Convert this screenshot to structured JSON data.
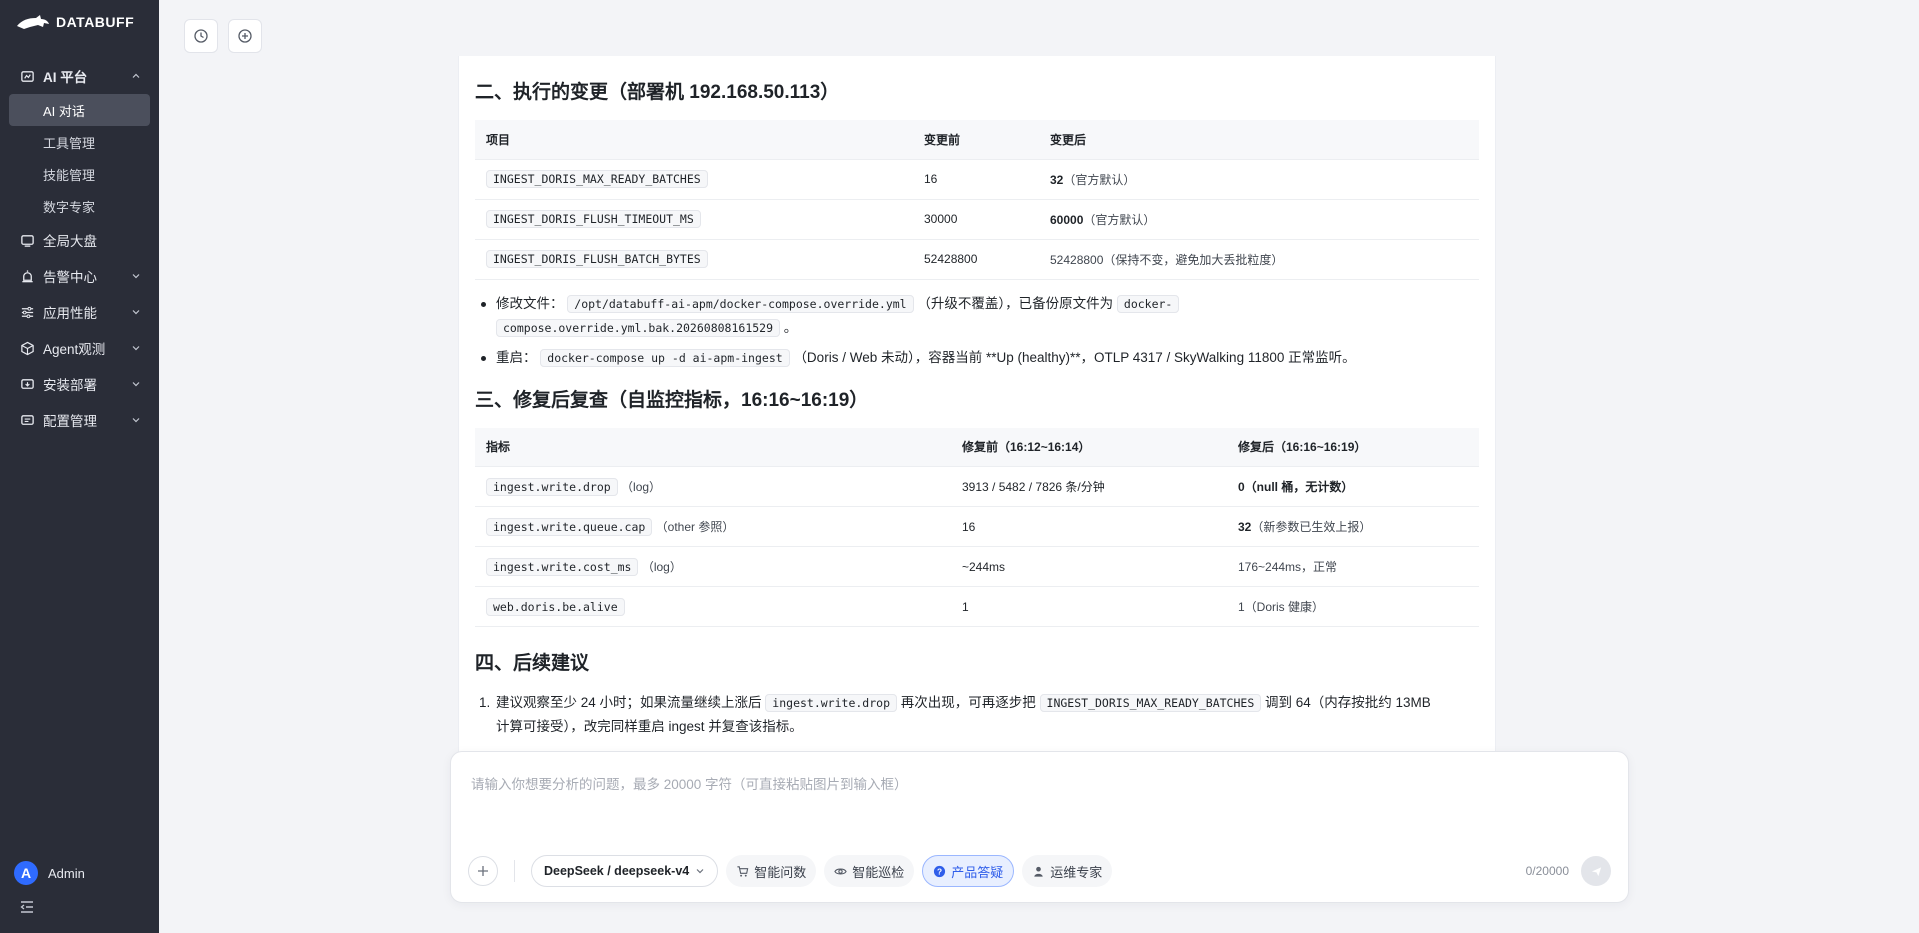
{
  "brand": {
    "name": "DATABUFF"
  },
  "sidebar": {
    "groups": [
      {
        "label": "AI 平台",
        "icon": "ai-platform-icon",
        "expanded": true,
        "items": [
          {
            "label": "AI 对话",
            "active": true
          },
          {
            "label": "工具管理"
          },
          {
            "label": "技能管理"
          },
          {
            "label": "数字专家"
          }
        ]
      },
      {
        "label": "全局大盘",
        "icon": "dashboard-icon"
      },
      {
        "label": "告警中心",
        "icon": "alarm-icon"
      },
      {
        "label": "应用性能",
        "icon": "performance-icon"
      },
      {
        "label": "Agent观测",
        "icon": "agent-icon"
      },
      {
        "label": "安装部署",
        "icon": "deploy-icon"
      },
      {
        "label": "配置管理",
        "icon": "config-icon"
      }
    ],
    "user": {
      "initial": "A",
      "name": "Admin"
    }
  },
  "sections": {
    "s2": {
      "title": "二、执行的变更（部署机 192.168.50.113）",
      "headers": [
        "项目",
        "变更前",
        "变更后"
      ],
      "rows": [
        {
          "item": "INGEST_DORIS_MAX_READY_BATCHES",
          "before": "16",
          "after_bold": "32",
          "after_note": "（官方默认）"
        },
        {
          "item": "INGEST_DORIS_FLUSH_TIMEOUT_MS",
          "before": "30000",
          "after_bold": "60000",
          "after_note": "（官方默认）"
        },
        {
          "item": "INGEST_DORIS_FLUSH_BATCH_BYTES",
          "before": "52428800",
          "after_bold": "",
          "after_note": "52428800（保持不变，避免加大丢批粒度）"
        }
      ],
      "bullets": {
        "b1_prefix": "修改文件：",
        "b1_code1": "/opt/databuff-ai-apm/docker-compose.override.yml",
        "b1_mid": "（升级不覆盖），已备份原文件为",
        "b1_code2a": "docker-",
        "b1_code2b": "compose.override.yml.bak.20260808161529",
        "b1_suffix": "。",
        "b2_prefix": "重启：",
        "b2_code": "docker-compose up -d ai-apm-ingest",
        "b2_suffix": "（Doris / Web 未动），容器当前 **Up (healthy)**，OTLP 4317 / SkyWalking 11800 正常监听。"
      }
    },
    "s3": {
      "title": "三、修复后复查（自监控指标，16:16~16:19）",
      "headers": [
        "指标",
        "修复前（16:12~16:14）",
        "修复后（16:16~16:19）"
      ],
      "rows": [
        {
          "metric": "ingest.write.drop",
          "metric_note": "（log）",
          "before": "3913 / 5482 / 7826 条/分钟",
          "after_bold": "0（null 桶，无计数）",
          "after_note": ""
        },
        {
          "metric": "ingest.write.queue.cap",
          "metric_note": "（other 参照）",
          "before": "16",
          "after_bold": "32",
          "after_note": "（新参数已生效上报）"
        },
        {
          "metric": "ingest.write.cost_ms",
          "metric_note": "（log）",
          "before": "~244ms",
          "after_bold": "",
          "after_note": "176~244ms，正常"
        },
        {
          "metric": "web.doris.be.alive",
          "metric_note": "",
          "before": "1",
          "after_bold": "",
          "after_note": "1（Doris 健康）"
        }
      ]
    },
    "s4": {
      "title": "四、后续建议",
      "items": {
        "n1_num": "1.",
        "n1_prefix": "建议观察至少 24 小时；如果流量继续上涨后",
        "n1_code1": "ingest.write.drop",
        "n1_mid": "再次出现，可再逐步把",
        "n1_code2": "INGEST_DORIS_MAX_READY_BATCHES",
        "n1_suffix": "调到 64（内存按批约 13MB",
        "n1_line2": "计算可接受），改完同样重启 ingest 并复查该指标。"
      }
    }
  },
  "composer": {
    "placeholder": "请输入你想要分析的问题，最多 20000 字符（可直接粘贴图片到输入框）",
    "model": "DeepSeek / deepseek-v4",
    "modes": [
      {
        "label": "智能问数",
        "icon": "cart-icon"
      },
      {
        "label": "智能巡检",
        "icon": "eye-icon"
      },
      {
        "label": "产品答疑",
        "icon": "question-icon",
        "active": true
      },
      {
        "label": "运维专家",
        "icon": "person-icon"
      }
    ],
    "counter": "0/20000"
  },
  "colors": {
    "sidebar_bg": "#2a2d38",
    "accent": "#2f5eea",
    "page_bg": "#f3f4f7"
  }
}
